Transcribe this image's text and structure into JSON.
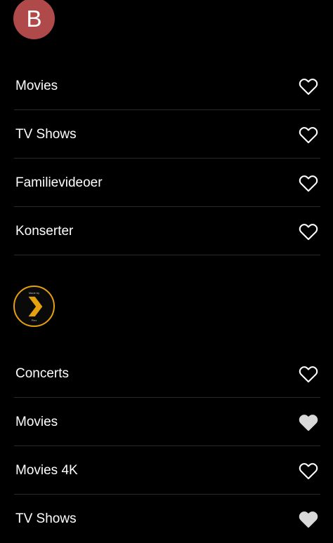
{
  "colors": {
    "background": "#000000",
    "text": "#ffffff",
    "divider": "#2a2a2a",
    "avatar_bg": "#b04a4a",
    "heart_outline": "#ffffff",
    "heart_filled": "#d9d9d9",
    "plex_orange": "#e5a00d"
  },
  "servers": [
    {
      "avatar": {
        "type": "letter",
        "letter": "B"
      },
      "libraries": [
        {
          "label": "Movies",
          "favorite": false,
          "icon": "heart-outline-icon"
        },
        {
          "label": "TV Shows",
          "favorite": false,
          "icon": "heart-outline-icon"
        },
        {
          "label": "Familievideoer",
          "favorite": false,
          "icon": "heart-outline-icon"
        },
        {
          "label": "Konserter",
          "favorite": false,
          "icon": "heart-outline-icon"
        }
      ]
    },
    {
      "avatar": {
        "type": "logo",
        "logo": "plex-chevron-icon",
        "top_text": "Made by",
        "bottom_text": "Plex"
      },
      "libraries": [
        {
          "label": "Concerts",
          "favorite": false,
          "icon": "heart-outline-icon"
        },
        {
          "label": "Movies",
          "favorite": true,
          "icon": "heart-filled-icon"
        },
        {
          "label": "Movies 4K",
          "favorite": false,
          "icon": "heart-outline-icon"
        },
        {
          "label": "TV Shows",
          "favorite": true,
          "icon": "heart-filled-icon"
        }
      ]
    }
  ]
}
